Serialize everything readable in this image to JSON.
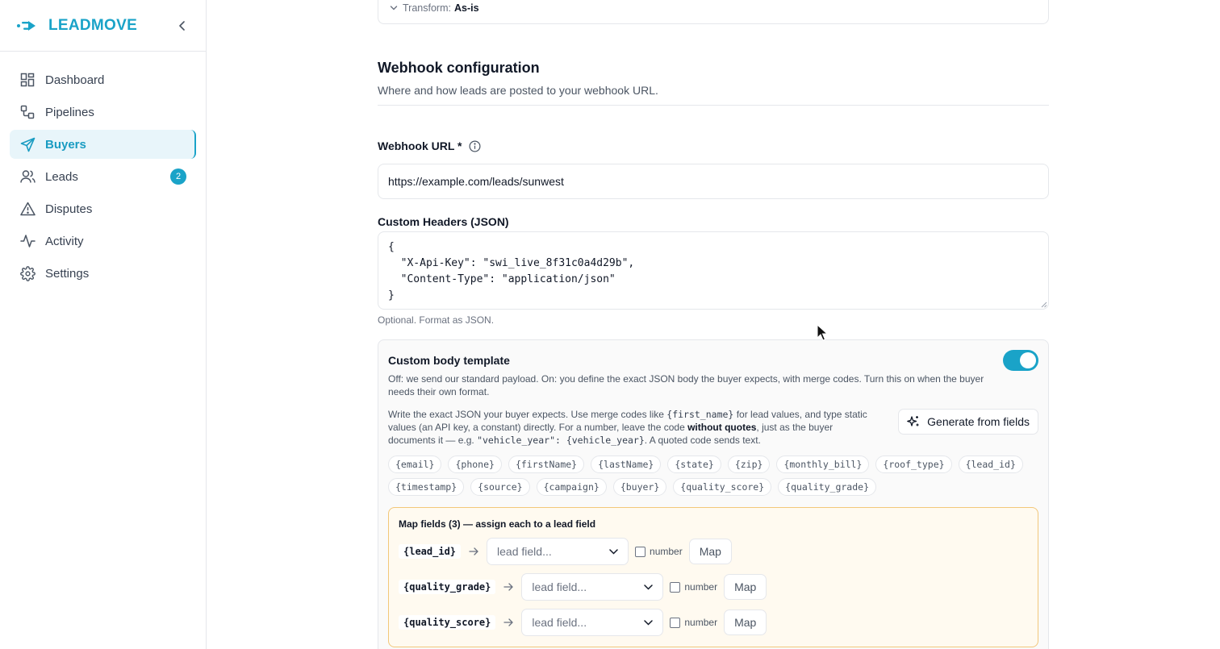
{
  "brand": {
    "name": "LEADMOVE"
  },
  "sidebar": {
    "items": [
      {
        "label": "Dashboard",
        "icon": "dashboard-icon"
      },
      {
        "label": "Pipelines",
        "icon": "pipelines-icon"
      },
      {
        "label": "Buyers",
        "icon": "send-icon",
        "active": true
      },
      {
        "label": "Leads",
        "icon": "users-icon",
        "badge": "2"
      },
      {
        "label": "Disputes",
        "icon": "warning-icon"
      },
      {
        "label": "Activity",
        "icon": "activity-icon"
      },
      {
        "label": "Settings",
        "icon": "gear-icon"
      }
    ]
  },
  "transform": {
    "label": "Transform:",
    "value": "As-is"
  },
  "webhook": {
    "title": "Webhook configuration",
    "subtitle": "Where and how leads are posted to your webhook URL.",
    "url_label": "Webhook URL *",
    "url_value": "https://example.com/leads/sunwest",
    "headers_label": "Custom Headers (JSON)",
    "headers_value": "{\n  \"X-Api-Key\": \"swi_live_8f31c0a4d29b\",\n  \"Content-Type\": \"application/json\"\n}",
    "headers_hint": "Optional. Format as JSON."
  },
  "body_template": {
    "title": "Custom body template",
    "enabled": true,
    "description": "Off: we send our standard payload. On: you define the exact JSON body the buyer expects, with merge codes. Turn this on when the buyer needs their own format.",
    "help_1": "Write the exact JSON your buyer expects. Use merge codes like ",
    "help_code_1": "{first_name}",
    "help_2": " for lead values, and type static values (an API key, a constant) directly. For a number, leave the code ",
    "help_bold": "without quotes",
    "help_3": ", just as the buyer documents it — e.g. ",
    "help_code_2": "\"vehicle_year\": {vehicle_year}",
    "help_4": ". A quoted code sends text.",
    "generate_label": "Generate from fields",
    "chips": [
      "{email}",
      "{phone}",
      "{firstName}",
      "{lastName}",
      "{state}",
      "{zip}",
      "{monthly_bill}",
      "{roof_type}",
      "{lead_id}",
      "{timestamp}",
      "{source}",
      "{campaign}",
      "{buyer}",
      "{quality_score}",
      "{quality_grade}"
    ],
    "map": {
      "title": "Map fields (3) — assign each to a lead field",
      "rows": [
        {
          "code": "{lead_id}",
          "placeholder": "lead field...",
          "number_label": "number",
          "button": "Map"
        },
        {
          "code": "{quality_grade}",
          "placeholder": "lead field...",
          "number_label": "number",
          "button": "Map"
        },
        {
          "code": "{quality_score}",
          "placeholder": "lead field...",
          "number_label": "number",
          "button": "Map"
        }
      ]
    }
  },
  "colors": {
    "accent": "#1aa3c8",
    "map_border": "#f2c77a",
    "map_bg": "#fffaf0"
  }
}
